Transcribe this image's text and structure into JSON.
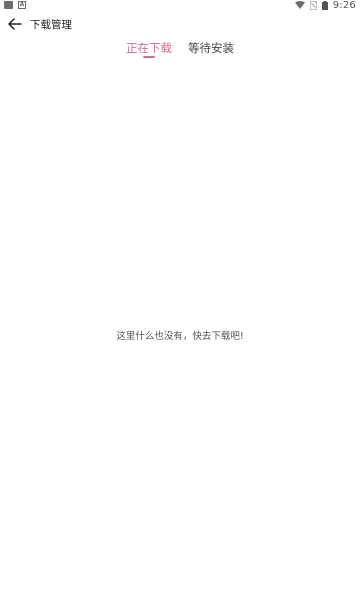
{
  "status_bar": {
    "time": "9:26",
    "notification_badge": "A"
  },
  "app_bar": {
    "title": "下载管理"
  },
  "tabs": [
    {
      "label": "正在下载",
      "active": true
    },
    {
      "label": "等待安装",
      "active": false
    }
  ],
  "empty_state": {
    "message": "这里什么也没有，快去下载吧!"
  },
  "colors": {
    "accent": "#e06a8e",
    "text": "#222222",
    "muted": "#555555"
  }
}
